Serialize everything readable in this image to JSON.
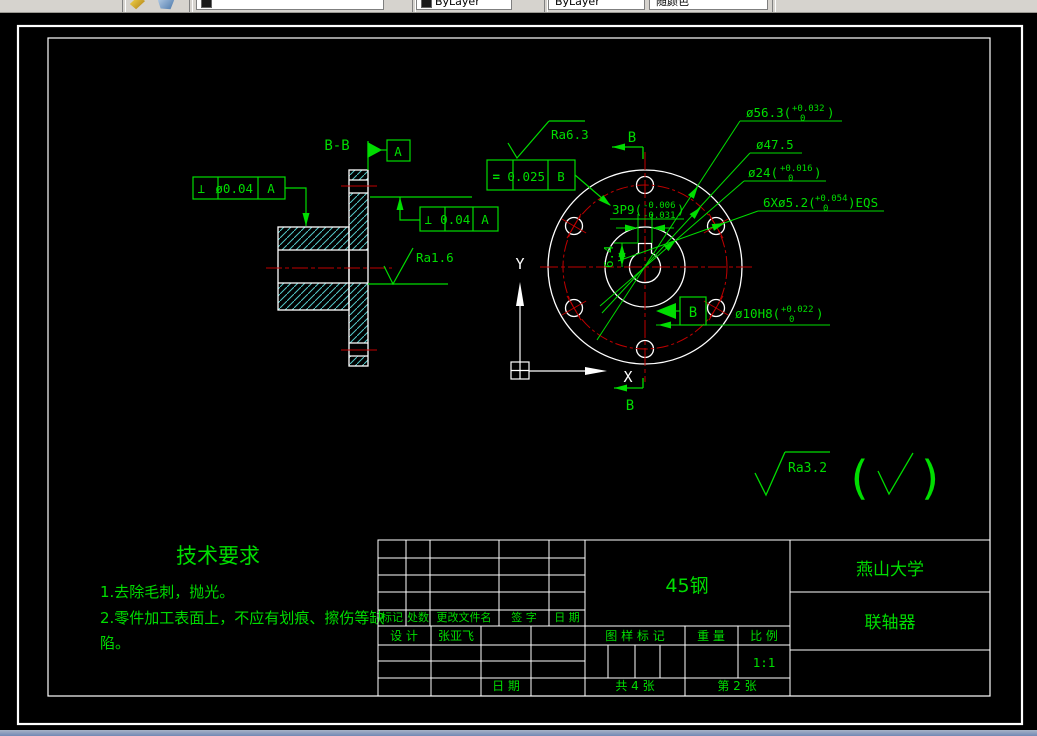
{
  "colors": {
    "annotation_green": "#00dd00",
    "geometry_white": "#ffffff",
    "centerline_red": "#c00000",
    "hatch_cyan": "#55c8c8",
    "canvas_bg": "#000000",
    "toolbar_bg": "#d6d3ce"
  },
  "toolbar": {
    "combos": [
      "",
      "ByLayer",
      "ByLayer",
      "随颜色"
    ]
  },
  "left_view": {
    "section_label": "B-B",
    "datum_a": "A",
    "fcf_position": {
      "sym": "⊥",
      "tol": "ø0.04",
      "datum": "A"
    },
    "fcf_perp": {
      "sym": "⊥",
      "tol": "0.04",
      "datum": "A"
    },
    "ra_bore": "Ra1.6"
  },
  "front_view": {
    "ra_face": "Ra6.3",
    "fcf_parallel": {
      "sym": "=",
      "tol": "0.025",
      "datum": "B"
    },
    "section_b_top": "B",
    "section_b_bottom": "B",
    "datum_b": "B",
    "ucs_x": "X",
    "ucs_y": "Y",
    "dim_keyway_depth": "6.4",
    "dim_keyway": {
      "pre": "3P9(",
      "up": "-0.006",
      "low": "-0.031",
      "post": ")"
    },
    "dim_outer": {
      "pre": "ø56.3(",
      "up": "+0.032",
      "low": "0",
      "post": ")"
    },
    "dim_bolt_circle": "ø47.5",
    "dim_boss": {
      "pre": "ø24(",
      "up": "+0.016",
      "low": "0",
      "post": ")"
    },
    "dim_holes": {
      "pre": "6Xø5.2(",
      "up": "+0.054",
      "low": "0",
      "post": ")EQS"
    },
    "dim_bore": {
      "pre": "ø10H8(",
      "up": "+0.022",
      "low": "0",
      "post": ")"
    }
  },
  "surface_note": {
    "ra": "Ra3.2",
    "paren_open": "(",
    "check": "√",
    "paren_close": ")"
  },
  "tech_req": {
    "title": "技术要求",
    "line1": "1.去除毛刺，抛光。",
    "line2": "2.零件加工表面上，不应有划痕、擦伤等缺",
    "line3": "陷。"
  },
  "title_block": {
    "material": "45钢",
    "org": "燕山大学",
    "part_name": "联轴器",
    "rev_headers": [
      "标记",
      "处数",
      "更改文件名",
      "签 字",
      "日 期"
    ],
    "design_label": "设 计",
    "designer": "张亚飞",
    "date_label": "日 期",
    "stamp_label": "图 样 标 记",
    "weight_label": "重 量",
    "scale_label": "比 例",
    "scale_value": "1:1",
    "sheet_total": "共 4 张",
    "sheet_no": "第 2 张"
  }
}
